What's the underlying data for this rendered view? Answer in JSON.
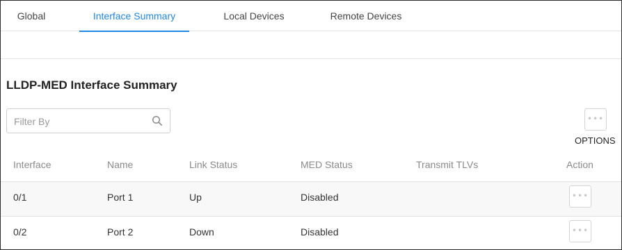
{
  "tabs": [
    {
      "label": "Global",
      "active": false
    },
    {
      "label": "Interface Summary",
      "active": true
    },
    {
      "label": "Local Devices",
      "active": false
    },
    {
      "label": "Remote Devices",
      "active": false
    }
  ],
  "section": {
    "title": "LLDP-MED Interface Summary"
  },
  "filter": {
    "placeholder": "Filter By",
    "value": "",
    "icon": "search-icon"
  },
  "options": {
    "label": "OPTIONS",
    "icon": "more-horizontal-icon"
  },
  "colors": {
    "accent": "#1e88e5",
    "header_text": "#8a8a8a",
    "row_alt": "#f8f8f8"
  },
  "table": {
    "columns": [
      "Interface",
      "Name",
      "Link Status",
      "MED Status",
      "Transmit TLVs",
      "Action"
    ],
    "rows": [
      {
        "interface": "0/1",
        "name": "Port 1",
        "link_status": "Up",
        "med_status": "Disabled",
        "transmit_tlvs": ""
      },
      {
        "interface": "0/2",
        "name": "Port 2",
        "link_status": "Down",
        "med_status": "Disabled",
        "transmit_tlvs": ""
      }
    ]
  }
}
